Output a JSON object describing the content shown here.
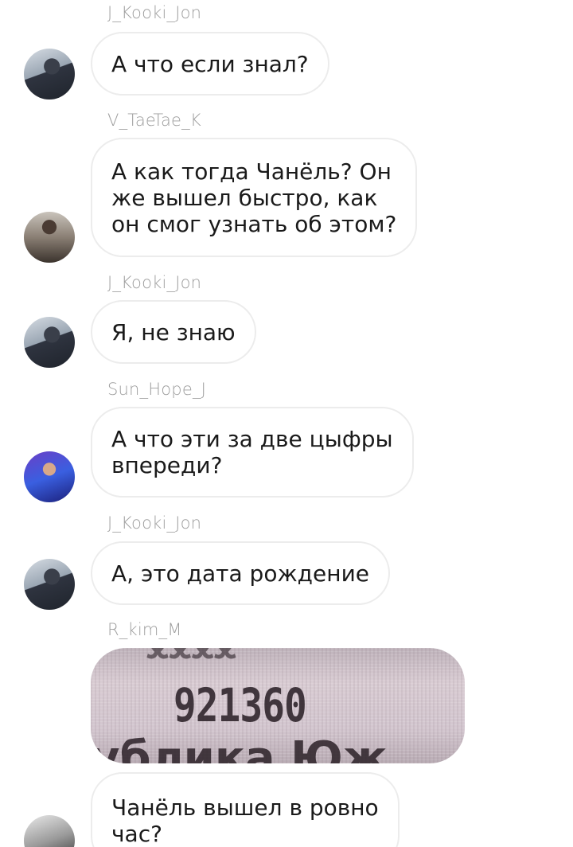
{
  "messages": [
    {
      "sender": "J_Kooki_Jon",
      "text": "А что если знал?",
      "avatar_icon": "user-avatar-jungkook"
    },
    {
      "sender": "V_TaeTae_K",
      "lines": [
        "А как тогда Чанёль? Он",
        "же вышел быстро, как",
        "он смог узнать об этом?"
      ],
      "avatar_icon": "user-avatar-v"
    },
    {
      "sender": "J_Kooki_Jon",
      "text": "Я, не знаю",
      "avatar_icon": "user-avatar-jungkook"
    },
    {
      "sender": "Sun_Hope_J",
      "lines": [
        "А что эти за две цыфры",
        "впереди?"
      ],
      "avatar_icon": "user-avatar-hope"
    },
    {
      "sender": "J_Kooki_Jon",
      "text": "А, это дата рождение",
      "avatar_icon": "user-avatar-jungkook"
    },
    {
      "sender": "R_kim_M",
      "image": {
        "number": "921360",
        "bottom_text": "ублика Юж"
      },
      "avatar_icon": "user-avatar-namjoon"
    },
    {
      "lines": [
        "Чанёль вышел в ровно",
        "час?"
      ],
      "avatar_icon": "user-avatar-namjoon"
    }
  ]
}
